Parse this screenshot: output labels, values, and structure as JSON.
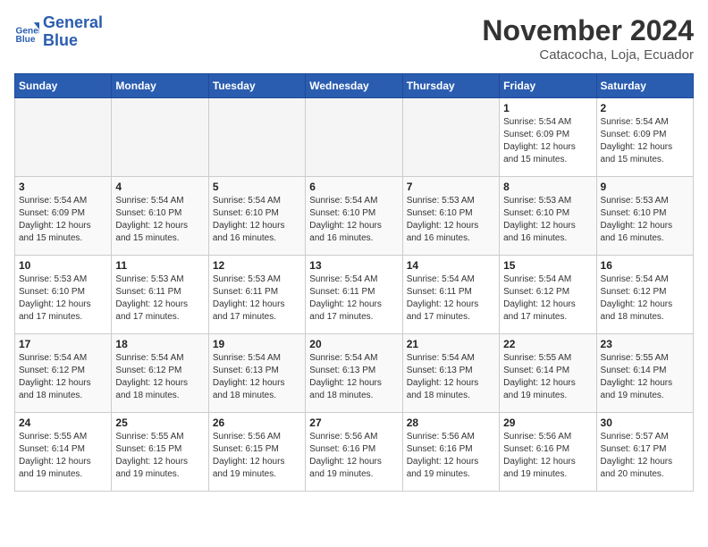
{
  "header": {
    "logo_line1": "General",
    "logo_line2": "Blue",
    "month_title": "November 2024",
    "subtitle": "Catacocha, Loja, Ecuador"
  },
  "weekdays": [
    "Sunday",
    "Monday",
    "Tuesday",
    "Wednesday",
    "Thursday",
    "Friday",
    "Saturday"
  ],
  "weeks": [
    [
      {
        "day": "",
        "info": ""
      },
      {
        "day": "",
        "info": ""
      },
      {
        "day": "",
        "info": ""
      },
      {
        "day": "",
        "info": ""
      },
      {
        "day": "",
        "info": ""
      },
      {
        "day": "1",
        "info": "Sunrise: 5:54 AM\nSunset: 6:09 PM\nDaylight: 12 hours\nand 15 minutes."
      },
      {
        "day": "2",
        "info": "Sunrise: 5:54 AM\nSunset: 6:09 PM\nDaylight: 12 hours\nand 15 minutes."
      }
    ],
    [
      {
        "day": "3",
        "info": "Sunrise: 5:54 AM\nSunset: 6:09 PM\nDaylight: 12 hours\nand 15 minutes."
      },
      {
        "day": "4",
        "info": "Sunrise: 5:54 AM\nSunset: 6:10 PM\nDaylight: 12 hours\nand 15 minutes."
      },
      {
        "day": "5",
        "info": "Sunrise: 5:54 AM\nSunset: 6:10 PM\nDaylight: 12 hours\nand 16 minutes."
      },
      {
        "day": "6",
        "info": "Sunrise: 5:54 AM\nSunset: 6:10 PM\nDaylight: 12 hours\nand 16 minutes."
      },
      {
        "day": "7",
        "info": "Sunrise: 5:53 AM\nSunset: 6:10 PM\nDaylight: 12 hours\nand 16 minutes."
      },
      {
        "day": "8",
        "info": "Sunrise: 5:53 AM\nSunset: 6:10 PM\nDaylight: 12 hours\nand 16 minutes."
      },
      {
        "day": "9",
        "info": "Sunrise: 5:53 AM\nSunset: 6:10 PM\nDaylight: 12 hours\nand 16 minutes."
      }
    ],
    [
      {
        "day": "10",
        "info": "Sunrise: 5:53 AM\nSunset: 6:10 PM\nDaylight: 12 hours\nand 17 minutes."
      },
      {
        "day": "11",
        "info": "Sunrise: 5:53 AM\nSunset: 6:11 PM\nDaylight: 12 hours\nand 17 minutes."
      },
      {
        "day": "12",
        "info": "Sunrise: 5:53 AM\nSunset: 6:11 PM\nDaylight: 12 hours\nand 17 minutes."
      },
      {
        "day": "13",
        "info": "Sunrise: 5:54 AM\nSunset: 6:11 PM\nDaylight: 12 hours\nand 17 minutes."
      },
      {
        "day": "14",
        "info": "Sunrise: 5:54 AM\nSunset: 6:11 PM\nDaylight: 12 hours\nand 17 minutes."
      },
      {
        "day": "15",
        "info": "Sunrise: 5:54 AM\nSunset: 6:12 PM\nDaylight: 12 hours\nand 17 minutes."
      },
      {
        "day": "16",
        "info": "Sunrise: 5:54 AM\nSunset: 6:12 PM\nDaylight: 12 hours\nand 18 minutes."
      }
    ],
    [
      {
        "day": "17",
        "info": "Sunrise: 5:54 AM\nSunset: 6:12 PM\nDaylight: 12 hours\nand 18 minutes."
      },
      {
        "day": "18",
        "info": "Sunrise: 5:54 AM\nSunset: 6:12 PM\nDaylight: 12 hours\nand 18 minutes."
      },
      {
        "day": "19",
        "info": "Sunrise: 5:54 AM\nSunset: 6:13 PM\nDaylight: 12 hours\nand 18 minutes."
      },
      {
        "day": "20",
        "info": "Sunrise: 5:54 AM\nSunset: 6:13 PM\nDaylight: 12 hours\nand 18 minutes."
      },
      {
        "day": "21",
        "info": "Sunrise: 5:54 AM\nSunset: 6:13 PM\nDaylight: 12 hours\nand 18 minutes."
      },
      {
        "day": "22",
        "info": "Sunrise: 5:55 AM\nSunset: 6:14 PM\nDaylight: 12 hours\nand 19 minutes."
      },
      {
        "day": "23",
        "info": "Sunrise: 5:55 AM\nSunset: 6:14 PM\nDaylight: 12 hours\nand 19 minutes."
      }
    ],
    [
      {
        "day": "24",
        "info": "Sunrise: 5:55 AM\nSunset: 6:14 PM\nDaylight: 12 hours\nand 19 minutes."
      },
      {
        "day": "25",
        "info": "Sunrise: 5:55 AM\nSunset: 6:15 PM\nDaylight: 12 hours\nand 19 minutes."
      },
      {
        "day": "26",
        "info": "Sunrise: 5:56 AM\nSunset: 6:15 PM\nDaylight: 12 hours\nand 19 minutes."
      },
      {
        "day": "27",
        "info": "Sunrise: 5:56 AM\nSunset: 6:16 PM\nDaylight: 12 hours\nand 19 minutes."
      },
      {
        "day": "28",
        "info": "Sunrise: 5:56 AM\nSunset: 6:16 PM\nDaylight: 12 hours\nand 19 minutes."
      },
      {
        "day": "29",
        "info": "Sunrise: 5:56 AM\nSunset: 6:16 PM\nDaylight: 12 hours\nand 19 minutes."
      },
      {
        "day": "30",
        "info": "Sunrise: 5:57 AM\nSunset: 6:17 PM\nDaylight: 12 hours\nand 20 minutes."
      }
    ]
  ]
}
